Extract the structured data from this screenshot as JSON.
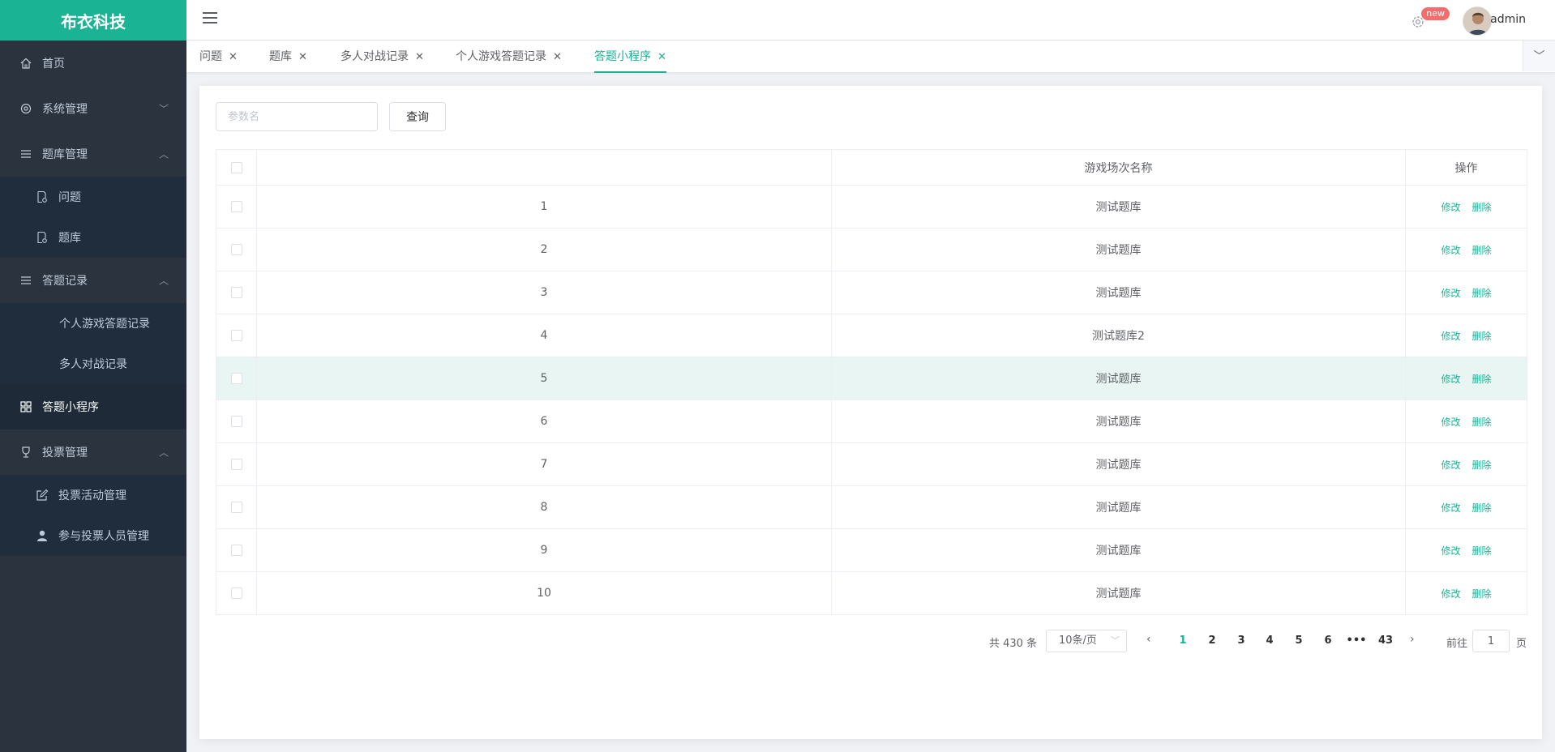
{
  "app": {
    "logo": "布衣科技"
  },
  "header": {
    "badge": "new",
    "username": "admin"
  },
  "sidebar": {
    "home": "首页",
    "system": "系统管理",
    "bank": "题库管理",
    "bank_items": [
      "问题",
      "题库"
    ],
    "records": "答题记录",
    "records_items": [
      "个人游戏答题记录",
      "多人对战记录"
    ],
    "miniapp": "答题小程序",
    "vote": "投票管理",
    "vote_items": [
      "投票活动管理",
      "参与投票人员管理"
    ]
  },
  "tabs": [
    {
      "label": "问题"
    },
    {
      "label": "题库"
    },
    {
      "label": "多人对战记录"
    },
    {
      "label": "个人游戏答题记录"
    },
    {
      "label": "答题小程序",
      "active": true
    }
  ],
  "search": {
    "placeholder": "参数名",
    "button": "查询"
  },
  "table": {
    "columns": [
      "",
      "游戏场次名称",
      "操作"
    ],
    "edit_label": "修改",
    "delete_label": "删除",
    "rows": [
      {
        "id": "1",
        "name": "测试题库"
      },
      {
        "id": "2",
        "name": "测试题库"
      },
      {
        "id": "3",
        "name": "测试题库"
      },
      {
        "id": "4",
        "name": "测试题库2"
      },
      {
        "id": "5",
        "name": "测试题库"
      },
      {
        "id": "6",
        "name": "测试题库"
      },
      {
        "id": "7",
        "name": "测试题库"
      },
      {
        "id": "8",
        "name": "测试题库"
      },
      {
        "id": "9",
        "name": "测试题库"
      },
      {
        "id": "10",
        "name": "测试题库"
      }
    ]
  },
  "pagination": {
    "total": "共 430 条",
    "page_size": "10条/页",
    "pages": [
      "1",
      "2",
      "3",
      "4",
      "5",
      "6",
      "•••",
      "43"
    ],
    "current": "1",
    "goto_label": "前往",
    "goto_value": "1",
    "page_unit": "页"
  },
  "colors": {
    "accent": "#1ab394",
    "sidebar": "#2b333e",
    "badge": "#f56c6c"
  }
}
